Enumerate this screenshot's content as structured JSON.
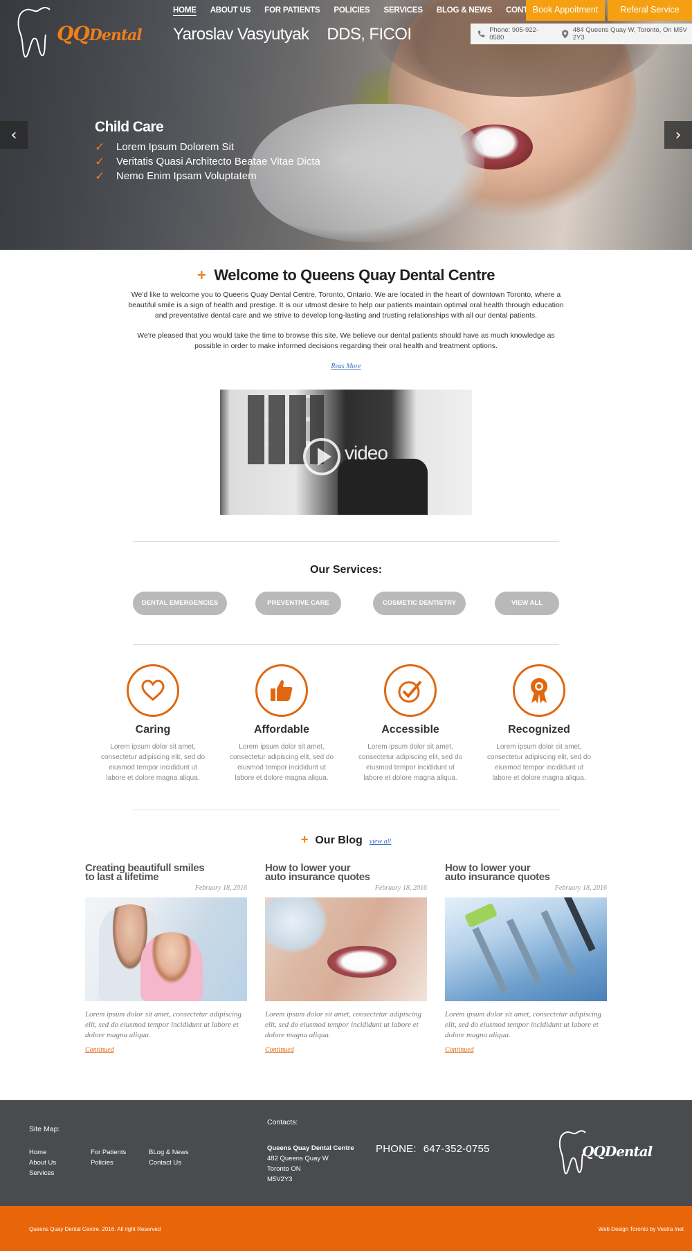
{
  "brand": {
    "logo_qq": "QQ",
    "logo_word": "Dental"
  },
  "nav": {
    "items": [
      {
        "label": "HOME",
        "active": true
      },
      {
        "label": "ABOUT US"
      },
      {
        "label": "FOR PATIENTS"
      },
      {
        "label": "POLICIES"
      },
      {
        "label": "SERVICES"
      },
      {
        "label": "BLOG & NEWS"
      },
      {
        "label": "CONTACT US"
      }
    ]
  },
  "header": {
    "doctor_name": "Yaroslav Vasyutyak",
    "doctor_credentials": "DDS, FICOI",
    "book_label": "Book Appoitment",
    "referral_label": "Referal Service",
    "phone": "Phone:  905-922-0580",
    "address": "484 Queens Quay W, Toronto, On M5V 2Y3"
  },
  "slider": {
    "title": "Child Care",
    "bullets": [
      "Lorem Ipsum Dolorem Sit",
      "Veritatis Quasi Architecto Beatae Vitae Dicta",
      "Nemo Enim Ipsam Voluptatem"
    ],
    "prev_icon": "chevron-left-icon",
    "next_icon": "chevron-right-icon"
  },
  "welcome": {
    "title": "Welcome to Queens Quay Dental Centre",
    "para1": "We'd like to welcome you to Queens Quay Dental Centre, Toronto, Ontario. We are located in the heart of downtown Toronto, where a beautiful smile is a sign of health and prestige. It is our utmost desire to help our patients maintain optimal oral health through education and preventative dental care and we strive to develop long-lasting and trusting relationships with all our dental patients.",
    "para2": "We're pleased that you would take the time to browse this site. We believe our dental patients should have as much knowledge as possible in order to make informed decisions regarding their oral health and treatment options.",
    "read_more": "Reas More",
    "video_label": "video"
  },
  "services": {
    "title": "Our Services:",
    "buttons": [
      "DENTAL EMERGENCIES",
      "PREVENTIVE CARE",
      "COSMETIC DENTISTRY",
      "VIEW ALL"
    ]
  },
  "features": [
    {
      "title": "Caring",
      "icon": "heart-icon",
      "text": "Lorem ipsum dolor sit amet, consectetur adipiscing elit, sed do eiusmod tempor incididunt ut labore et dolore magna aliqua."
    },
    {
      "title": "Affordable",
      "icon": "thumbs-up-icon",
      "text": "Lorem ipsum dolor sit amet, consectetur adipiscing elit, sed do eiusmod tempor incididunt ut labore et dolore magna aliqua."
    },
    {
      "title": "Accessible",
      "icon": "check-circle-icon",
      "text": "Lorem ipsum dolor sit amet, consectetur adipiscing elit, sed do eiusmod tempor incididunt ut labore et dolore magna aliqua."
    },
    {
      "title": "Recognized",
      "icon": "award-ribbon-icon",
      "text": "Lorem ipsum dolor sit amet, consectetur adipiscing elit, sed do eiusmod tempor incididunt ut labore et dolore magna aliqua."
    }
  ],
  "blog": {
    "title": "Our Blog",
    "view_all": "view all",
    "posts": [
      {
        "title_line1": "Creating beautifull smiles",
        "title_line2": "to last a lifetime",
        "date": "February 18, 2016",
        "excerpt": "Lorem ipsum dolor sit amet, consectetur adipiscing elit, sed do eiusmod tempor incididunt ut labore et dolore magna aliqua.",
        "more": "Continued"
      },
      {
        "title_line1": "How to lower your",
        "title_line2": "auto insurance quotes",
        "date": "February 18, 2016",
        "excerpt": "Lorem ipsum dolor sit amet, consectetur adipiscing elit, sed do eiusmod tempor incididunt ut labore et dolore magna aliqua.",
        "more": "Continued"
      },
      {
        "title_line1": "How to lower your",
        "title_line2": "auto insurance quotes",
        "date": "February 18, 2016",
        "excerpt": "Lorem ipsum dolor sit amet, consectetur adipiscing elit, sed do eiusmod tempor incididunt ut labore et dolore magna aliqua.",
        "more": "Continued"
      }
    ]
  },
  "footer": {
    "sitemap_title": "Site Map:",
    "col1": [
      "Home",
      "About Us",
      "Services"
    ],
    "col2": [
      "For Patients",
      "Policies"
    ],
    "col3": [
      "BLog & News",
      "Contact Us"
    ],
    "contacts_title": "Contacts:",
    "address_name": "Queens Quay Dental Centre",
    "address_line1": "482 Queens Quay W",
    "address_line2": "Toronto ON",
    "address_line3": "M5V2Y3",
    "phone_label": "PHONE:",
    "phone_number": "647-352-0755",
    "copyright": "Queens Quay Dental Centre. 2016. All right Reserved",
    "credit": "Web Design Toronto by Vestra Inet"
  },
  "colors": {
    "accent": "#e8650a",
    "button_yellow": "#f4a012",
    "footer_bg": "#4a4b4f",
    "link_blue": "#3a73c4"
  }
}
